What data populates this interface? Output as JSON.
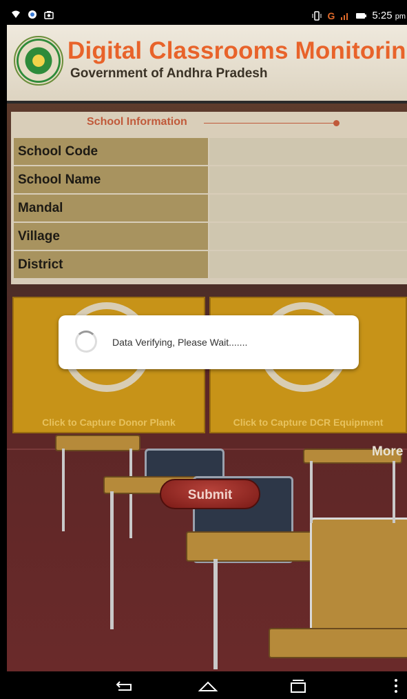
{
  "status_bar": {
    "time": "5:25",
    "time_suffix": "pm",
    "signal_text": "G",
    "left_icons": [
      "wifi-icon",
      "chrome-icon",
      "camera-icon"
    ],
    "right_icons": [
      "vibrate-icon",
      "signal-icon",
      "battery-icon"
    ]
  },
  "header": {
    "title": "Digital Classrooms Monitoring",
    "subtitle": "Government of Andhra Pradesh"
  },
  "school_info": {
    "section_label": "School Information",
    "rows": [
      {
        "label": "School Code",
        "value": ""
      },
      {
        "label": "School Name",
        "value": ""
      },
      {
        "label": "Mandal",
        "value": ""
      },
      {
        "label": "Village",
        "value": ""
      },
      {
        "label": "District",
        "value": ""
      }
    ]
  },
  "capture": [
    {
      "label": "Click to Capture Donor Plank"
    },
    {
      "label": "Click to Capture DCR Equipment"
    }
  ],
  "more_label": "More",
  "submit_label": "Submit",
  "dialog": {
    "message": "Data Verifying, Please Wait......."
  },
  "navbar": {
    "buttons": [
      "back-icon",
      "home-icon",
      "recent-apps-icon",
      "menu-icon"
    ]
  }
}
